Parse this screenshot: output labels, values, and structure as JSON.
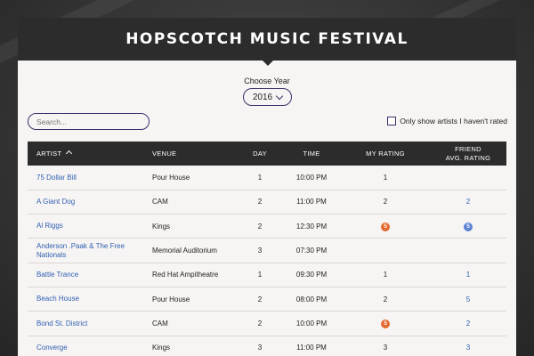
{
  "header": {
    "title": "HOPSCOTCH MUSIC FESTIVAL"
  },
  "year": {
    "label": "Choose Year",
    "value": "2016"
  },
  "search": {
    "placeholder": "Search..."
  },
  "filter": {
    "label": "Only show artists I haven't rated"
  },
  "colors": {
    "mine_badge": "#e46a2f",
    "friend_badge": "#5b82d4",
    "link": "#2f5fb3",
    "header_bg": "#2c2c2c"
  },
  "table": {
    "headers": {
      "artist": "ARTIST",
      "venue": "VENUE",
      "day": "DAY",
      "time": "TIME",
      "my_rating": "MY RATING",
      "friend_1": "FRIEND",
      "friend_2": "AVG. RATING"
    },
    "rows": [
      {
        "artist": "75 Dollar Bill",
        "venue": "Pour House",
        "day": "1",
        "time": "10:00 PM",
        "mine": "1",
        "friend": ""
      },
      {
        "artist": "A Giant Dog",
        "venue": "CAM",
        "day": "2",
        "time": "11:00 PM",
        "mine": "2",
        "friend": "2"
      },
      {
        "artist": "Al Riggs",
        "venue": "Kings",
        "day": "2",
        "time": "12:30 PM",
        "mine": "5",
        "mine_badge": true,
        "friend": "5",
        "friend_badge": true
      },
      {
        "artist": "Anderson .Paak & The Free Nationals",
        "venue": "Memorial Auditorium",
        "day": "3",
        "time": "07:30 PM",
        "mine": "",
        "friend": ""
      },
      {
        "artist": "Battle Trance",
        "venue": "Red Hat Ampitheatre",
        "day": "1",
        "time": "09:30 PM",
        "mine": "1",
        "friend": "1"
      },
      {
        "artist": "Beach House",
        "venue": "Pour House",
        "day": "2",
        "time": "08:00 PM",
        "mine": "2",
        "friend": "5"
      },
      {
        "artist": "Bond St. District",
        "venue": "CAM",
        "day": "2",
        "time": "10:00 PM",
        "mine": "5",
        "mine_badge": true,
        "friend": "2"
      },
      {
        "artist": "Converge",
        "venue": "Kings",
        "day": "3",
        "time": "11:00 PM",
        "mine": "3",
        "friend": "3"
      }
    ]
  }
}
